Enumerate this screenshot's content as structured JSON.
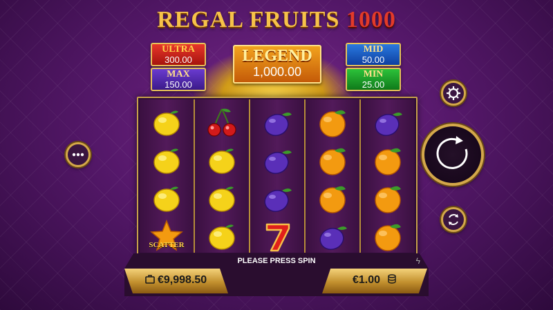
{
  "game": {
    "title_main": "REGAL FRUITS",
    "title_number": "1000"
  },
  "jackpots": {
    "ultra": {
      "label": "ULTRA",
      "value": "300.00"
    },
    "max": {
      "label": "MAX",
      "value": "150.00"
    },
    "legend": {
      "label": "LEGEND",
      "value": "1,000.00"
    },
    "mid": {
      "label": "MID",
      "value": "50.00"
    },
    "min": {
      "label": "MIN",
      "value": "25.00"
    }
  },
  "reels": [
    [
      "lemon-icon",
      "lemon-icon",
      "lemon-icon",
      "star-scatter-icon"
    ],
    [
      "cherry-icon",
      "lemon-icon",
      "lemon-icon",
      "lemon-icon"
    ],
    [
      "plum-icon",
      "plum-icon",
      "plum-icon",
      "seven-icon"
    ],
    [
      "orange-icon",
      "orange-icon",
      "orange-icon",
      "plum-icon"
    ],
    [
      "plum-icon",
      "orange-icon",
      "orange-icon",
      "orange-icon"
    ]
  ],
  "symbols": {
    "scatter_label": "SCATTER",
    "seven_label": "7"
  },
  "status": {
    "message": "PLEASE PRESS SPIN"
  },
  "balance": {
    "value": "€9,998.50",
    "icon": "briefcase-icon"
  },
  "bet": {
    "value": "€1.00",
    "icon": "coin-stack-icon"
  },
  "buttons": {
    "menu": "menu-icon",
    "settings": "gear-icon",
    "spin": "spin-icon",
    "autoplay": "autoplay-icon"
  },
  "colors": {
    "gold": "#d4a84a",
    "background": "#55186a",
    "legend": "#f2a31e"
  }
}
